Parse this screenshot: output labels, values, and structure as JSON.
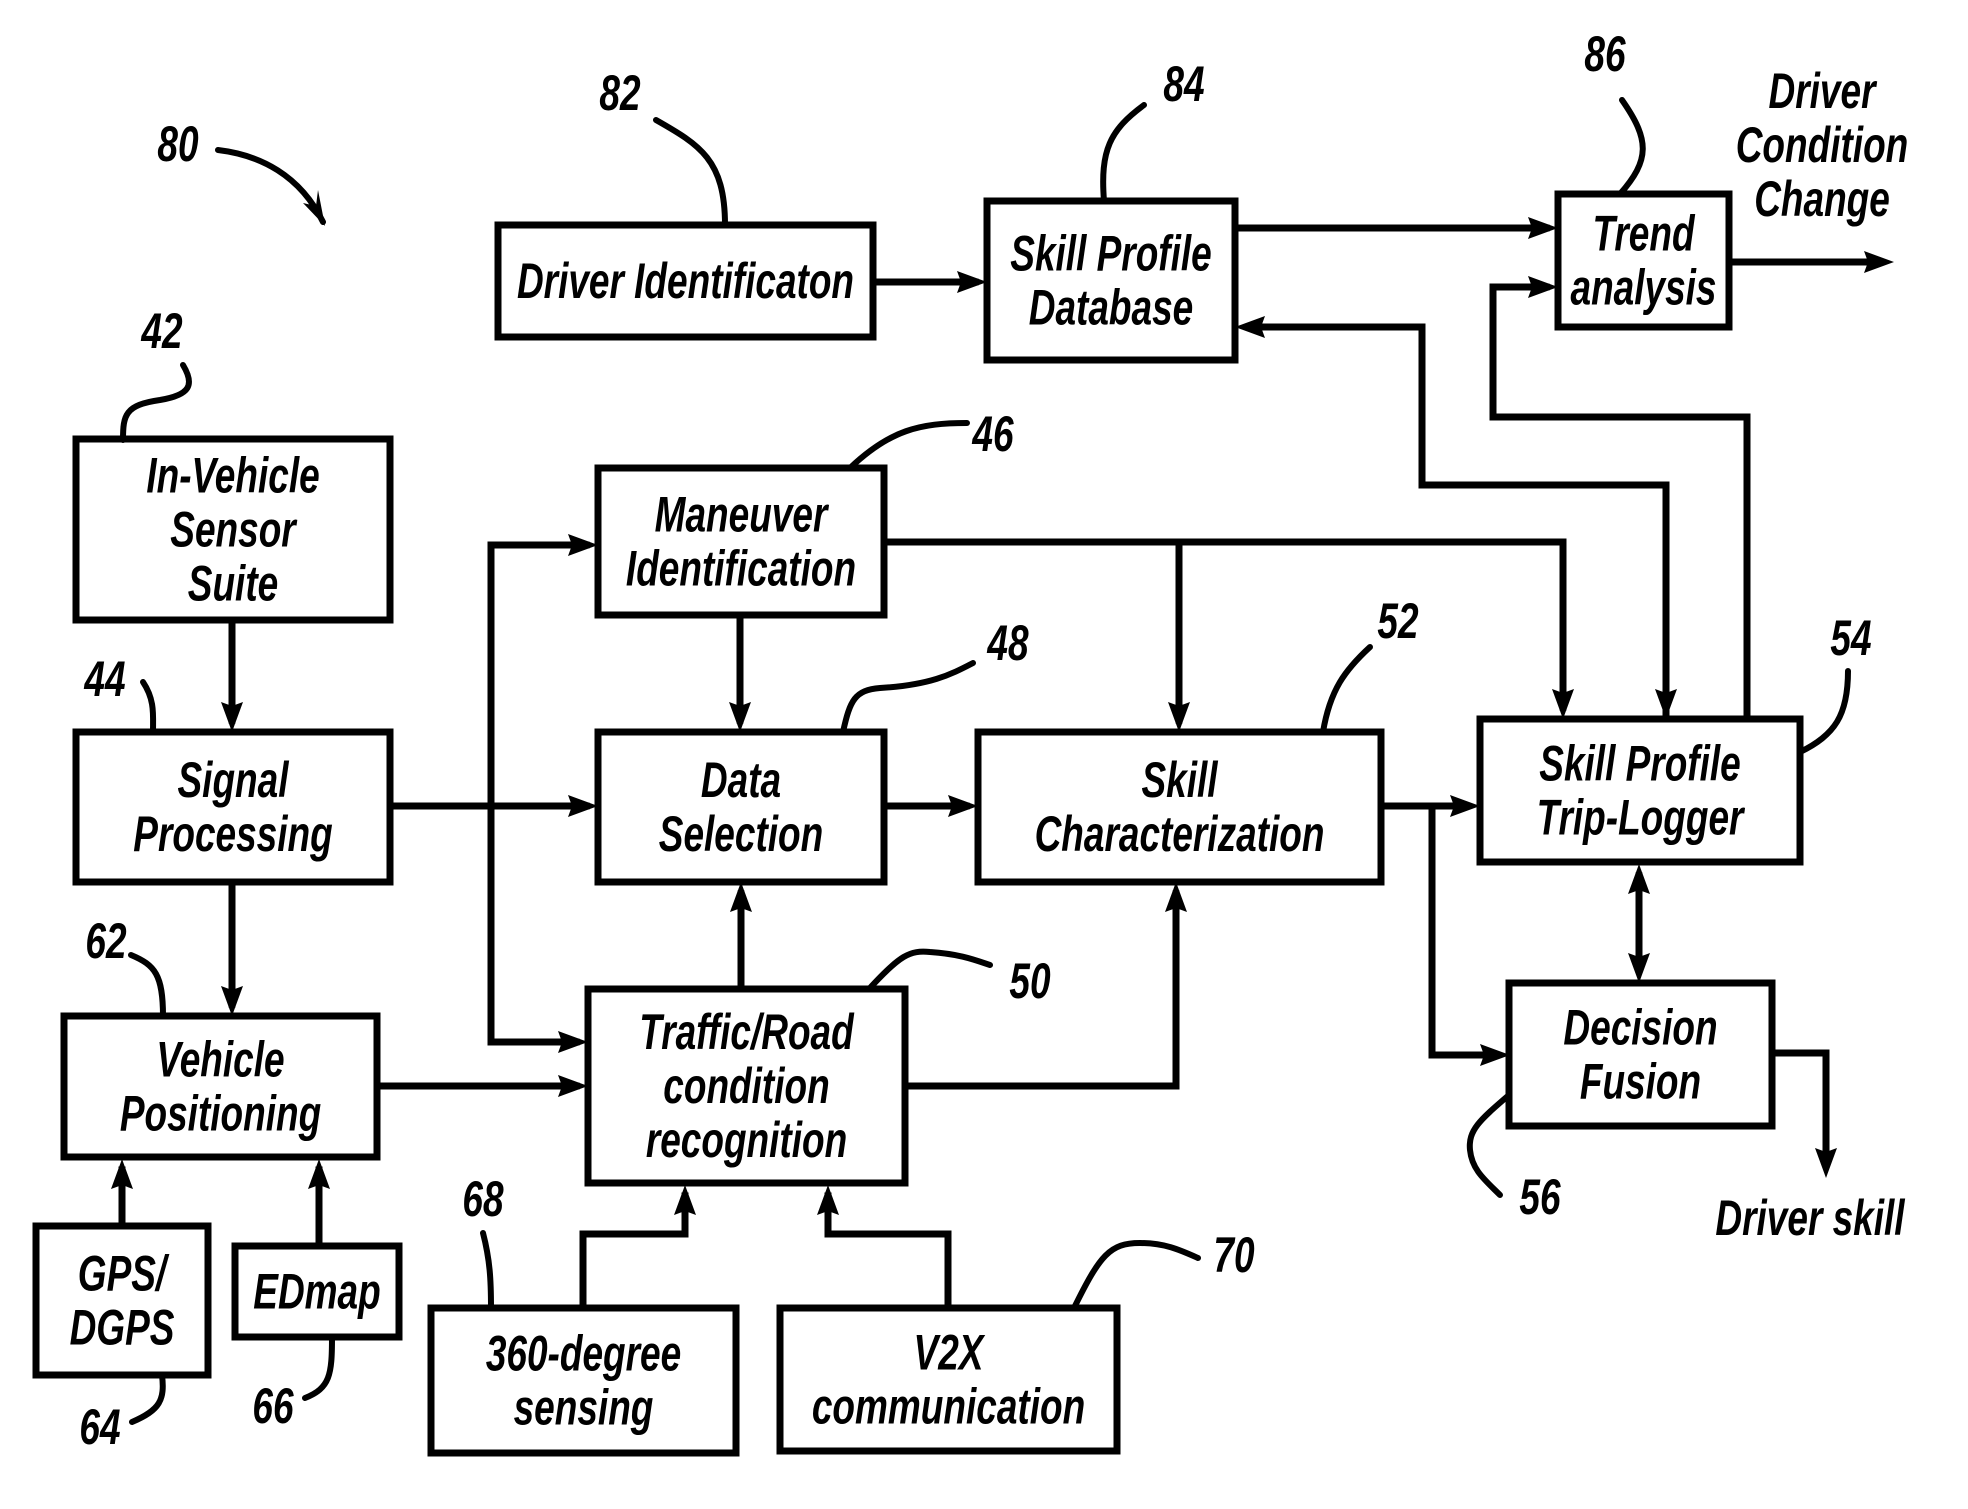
{
  "figure": {
    "reference_number": "80",
    "colors": {
      "line": "#000000",
      "background": "#ffffff"
    }
  },
  "blocks": {
    "in_vehicle_sensor_suite": {
      "ref": "42",
      "lines": [
        "In-Vehicle",
        "Sensor",
        "Suite"
      ]
    },
    "signal_processing": {
      "ref": "44",
      "lines": [
        "Signal",
        "Processing"
      ]
    },
    "maneuver_identification": {
      "ref": "46",
      "lines": [
        "Maneuver",
        "Identification"
      ]
    },
    "data_selection": {
      "ref": "48",
      "lines": [
        "Data",
        "Selection"
      ]
    },
    "traffic_road_recognition": {
      "ref": "50",
      "lines": [
        "Traffic/Road",
        "condition",
        "recognition"
      ]
    },
    "skill_characterization": {
      "ref": "52",
      "lines": [
        "Skill",
        "Characterization"
      ]
    },
    "skill_profile_trip_logger": {
      "ref": "54",
      "lines": [
        "Skill Profile",
        "Trip-Logger"
      ]
    },
    "decision_fusion": {
      "ref": "56",
      "lines": [
        "Decision",
        "Fusion"
      ]
    },
    "vehicle_positioning": {
      "ref": "62",
      "lines": [
        "Vehicle",
        "Positioning"
      ]
    },
    "gps_dgps": {
      "ref": "64",
      "lines": [
        "GPS/",
        "DGPS"
      ]
    },
    "edmap": {
      "ref": "66",
      "lines": [
        "EDmap"
      ]
    },
    "sensing_360": {
      "ref": "68",
      "lines": [
        "360-degree",
        "sensing"
      ]
    },
    "v2x_communication": {
      "ref": "70",
      "lines": [
        "V2X",
        "communication"
      ]
    },
    "driver_identification": {
      "ref": "82",
      "lines": [
        "Driver Identificaton"
      ]
    },
    "skill_profile_database": {
      "ref": "84",
      "lines": [
        "Skill Profile",
        "Database"
      ]
    },
    "trend_analysis": {
      "ref": "86",
      "lines": [
        "Trend",
        "analysis"
      ]
    }
  },
  "outputs": {
    "driver_condition_change": {
      "lines": [
        "Driver",
        "Condition",
        "Change"
      ]
    },
    "driver_skill": {
      "lines": [
        "Driver skill"
      ]
    }
  }
}
